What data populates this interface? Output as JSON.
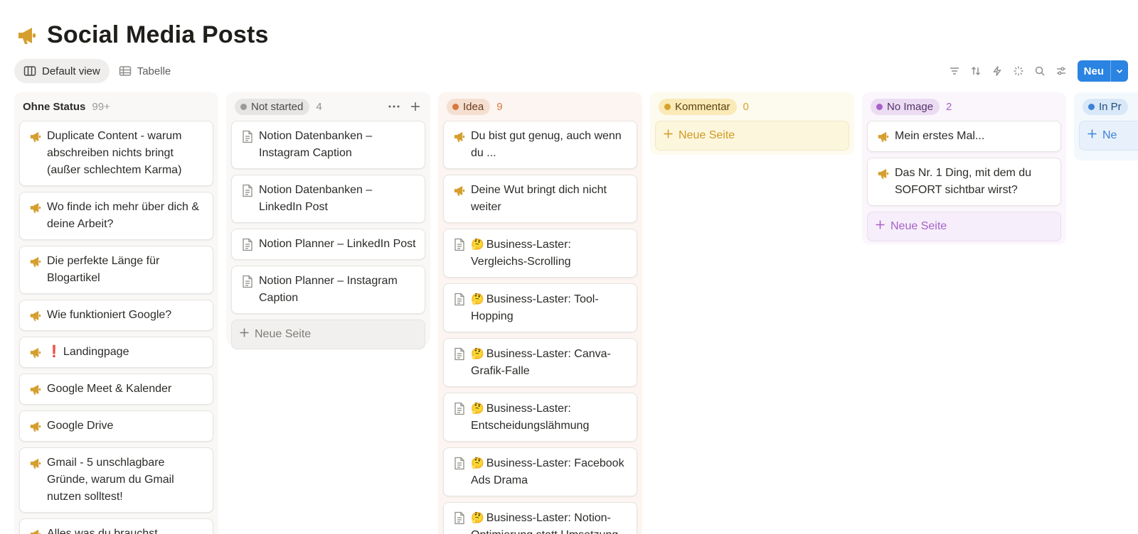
{
  "page": {
    "title": "Social Media Posts",
    "icon": "megaphone-icon"
  },
  "toolbar": {
    "views": [
      {
        "label": "Default view",
        "icon": "board-view-icon",
        "active": true
      },
      {
        "label": "Tabelle",
        "icon": "table-view-icon",
        "active": false
      }
    ],
    "actions": [
      "filter-icon",
      "sort-icon",
      "automation-bolt-icon",
      "ai-sparkle-icon",
      "search-icon",
      "settings-sliders-icon"
    ],
    "new_label": "Neu"
  },
  "colors": {
    "accent_blue": "#2b83e2",
    "megaphone": "#d59f2f"
  },
  "columns": [
    {
      "name": "Ohne Status",
      "count": "99+",
      "style": "plain",
      "cards": [
        {
          "icon": "megaphone-icon",
          "title": "Duplicate Content - warum abschreiben nichts bringt (außer schlechtem Karma)"
        },
        {
          "icon": "megaphone-icon",
          "title": "Wo finde ich mehr über dich & deine Arbeit?"
        },
        {
          "icon": "megaphone-icon",
          "title": "Die perfekte Länge für Blogartikel"
        },
        {
          "icon": "megaphone-icon",
          "title": "Wie funktioniert Google?"
        },
        {
          "icon": "megaphone-icon",
          "prefix": "❗",
          "title": "Landingpage"
        },
        {
          "icon": "megaphone-icon",
          "title": "Google Meet & Kalender"
        },
        {
          "icon": "megaphone-icon",
          "title": "Google Drive"
        },
        {
          "icon": "megaphone-icon",
          "title": "Gmail - 5 unschlagbare Gründe, warum du Gmail nutzen solltest!"
        },
        {
          "icon": "megaphone-icon",
          "title": "Alles was du brauchst"
        }
      ]
    },
    {
      "name": "Not started",
      "count": "4",
      "style": "gray",
      "cards": [
        {
          "icon": "page-icon",
          "title": "Notion Datenbanken – Instagram Caption"
        },
        {
          "icon": "page-icon",
          "title": "Notion Datenbanken – LinkedIn Post"
        },
        {
          "icon": "page-icon",
          "title": "Notion Planner – LinkedIn Post"
        },
        {
          "icon": "page-icon",
          "title": "Notion Planner – Instagram Caption"
        }
      ],
      "add_label": "Neue Seite"
    },
    {
      "name": "Idea",
      "count": "9",
      "style": "orange",
      "cards": [
        {
          "icon": "megaphone-icon",
          "title": "Du bist gut genug, auch wenn du ..."
        },
        {
          "icon": "megaphone-icon",
          "title": "Deine Wut bringt dich nicht weiter"
        },
        {
          "icon": "page-icon",
          "prefix": "🤔",
          "title": "Business-Laster: Vergleichs-Scrolling"
        },
        {
          "icon": "page-icon",
          "prefix": "🤔",
          "title": "Business-Laster: Tool-Hopping"
        },
        {
          "icon": "page-icon",
          "prefix": "🤔",
          "title": "Business-Laster: Canva-Grafik-Falle"
        },
        {
          "icon": "page-icon",
          "prefix": "🤔",
          "title": "Business-Laster: Entscheidungslähmung"
        },
        {
          "icon": "page-icon",
          "prefix": "🤔",
          "title": "Business-Laster: Facebook Ads Drama"
        },
        {
          "icon": "page-icon",
          "prefix": "🤔",
          "title": "Business-Laster: Notion-Optimierung statt Umsetzung"
        }
      ]
    },
    {
      "name": "Kommentar",
      "count": "0",
      "style": "yellow",
      "cards": [],
      "add_label": "Neue Seite"
    },
    {
      "name": "No Image",
      "count": "2",
      "style": "purple",
      "cards": [
        {
          "icon": "megaphone-icon",
          "title": "Mein erstes Mal..."
        },
        {
          "icon": "megaphone-icon",
          "title": "Das Nr. 1 Ding, mit dem du SOFORT sichtbar wirst?"
        }
      ],
      "add_label": "Neue Seite"
    },
    {
      "name": "In Pr",
      "count": "",
      "style": "blue",
      "cards": [],
      "add_label": "Ne"
    }
  ]
}
